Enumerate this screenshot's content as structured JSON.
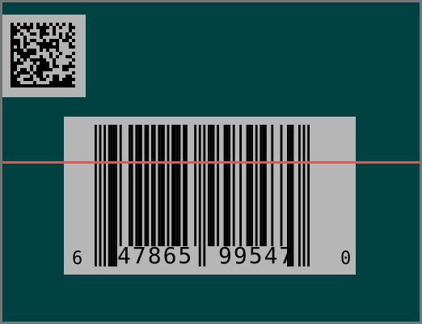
{
  "barcode": {
    "number_system_digit": "6",
    "left_digits": "47865",
    "right_digits": "99547",
    "check_digit": "0"
  },
  "colors": {
    "background": "#004141",
    "card": "#b6b6b6",
    "scan_line": "#ff4a4a",
    "ink": "#000000"
  },
  "icons": {
    "datamatrix": "datamatrix-code-icon",
    "barcode": "upc-barcode-icon"
  }
}
